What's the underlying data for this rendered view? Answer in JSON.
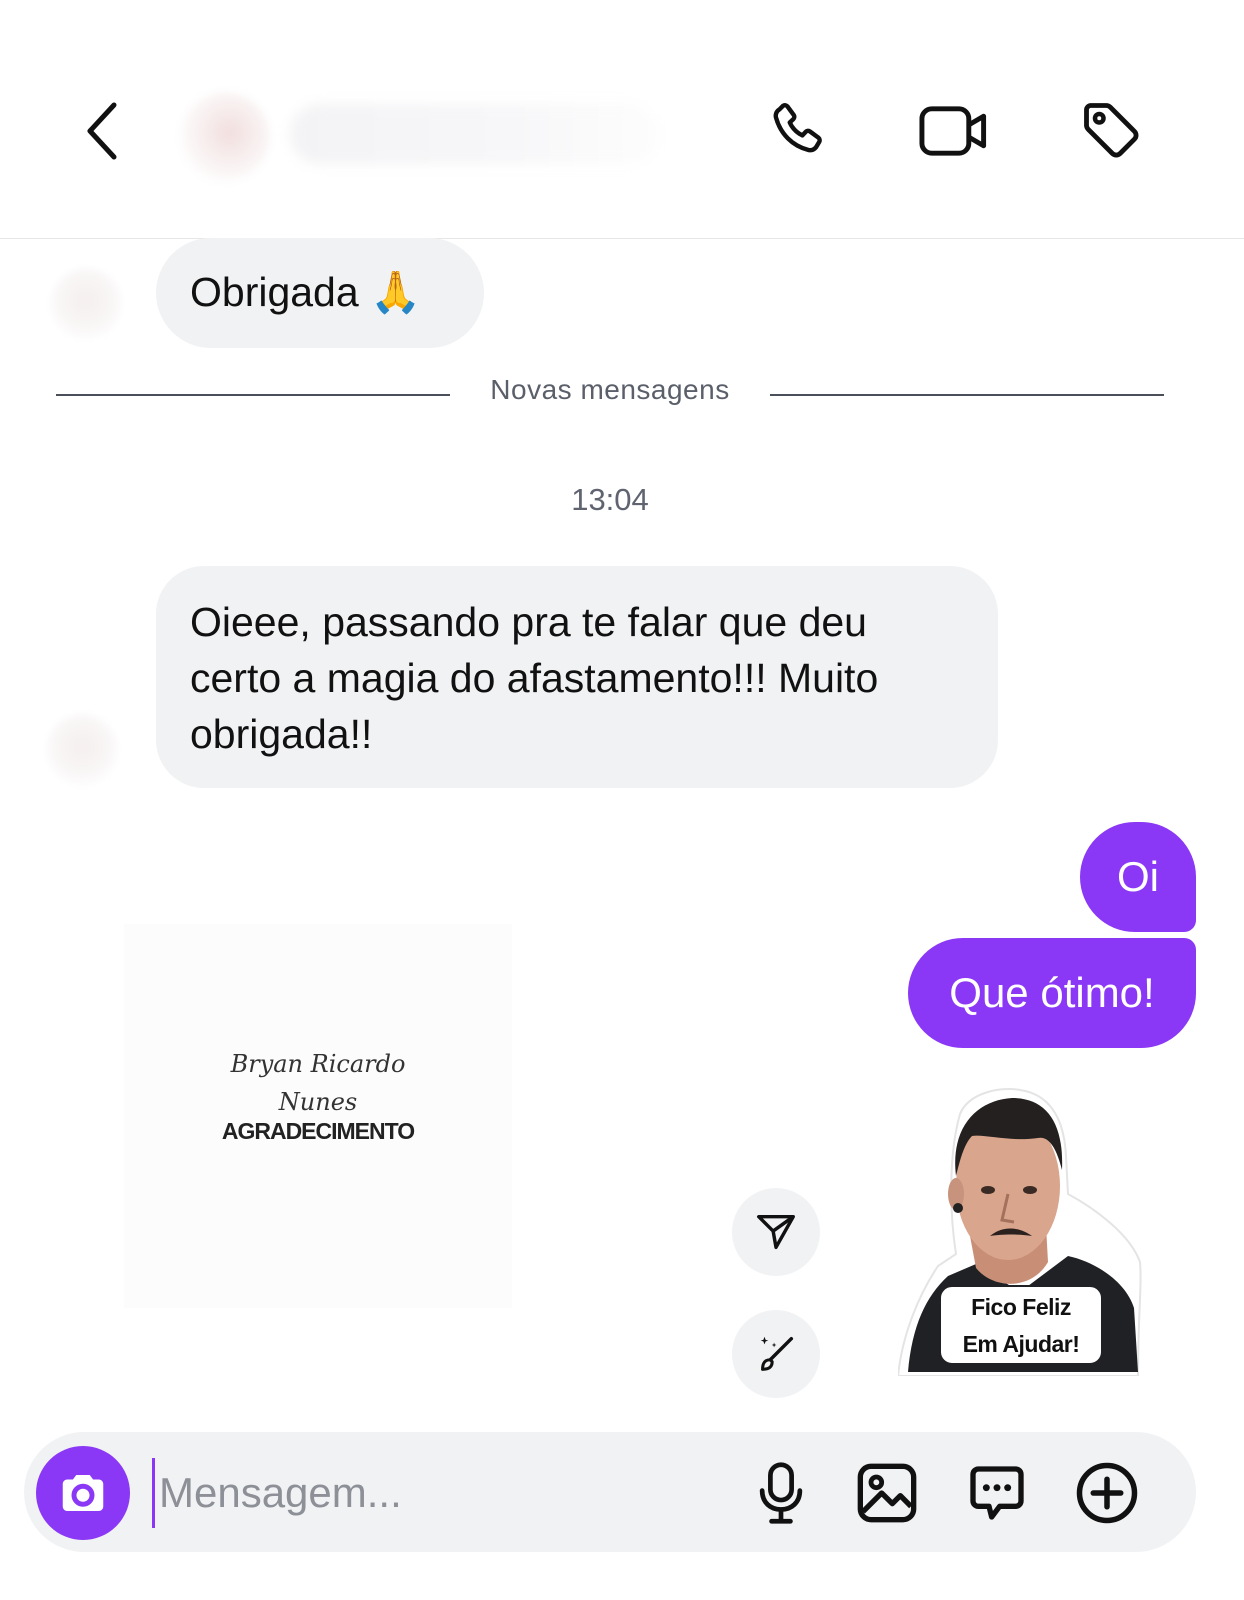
{
  "header": {
    "icons": [
      "back-icon",
      "phone-icon",
      "video-icon",
      "tag-icon"
    ]
  },
  "messages": {
    "first_incoming": "Obrigada 🙏",
    "divider_label": "Novas mensagens",
    "timestamp": "13:04",
    "second_incoming": "Oieee, passando pra te falar que deu certo a magia do afastamento!!! Muito obrigada!!",
    "outgoing_1": "Oi",
    "outgoing_2": "Que ótimo!"
  },
  "card": {
    "name_line1": "Bryan Ricardo",
    "name_line2": "Nunes",
    "title": "AGRADECIMENTO"
  },
  "sticker": {
    "caption_line1": "Fico Feliz",
    "caption_line2": "Em Ajudar!"
  },
  "composer": {
    "placeholder": "Mensagem...",
    "icons": [
      "camera-icon",
      "microphone-icon",
      "gallery-icon",
      "sticker-chat-icon",
      "plus-icon"
    ]
  },
  "colors": {
    "accent": "#8a38f5",
    "bubble_in": "#f1f2f4"
  }
}
